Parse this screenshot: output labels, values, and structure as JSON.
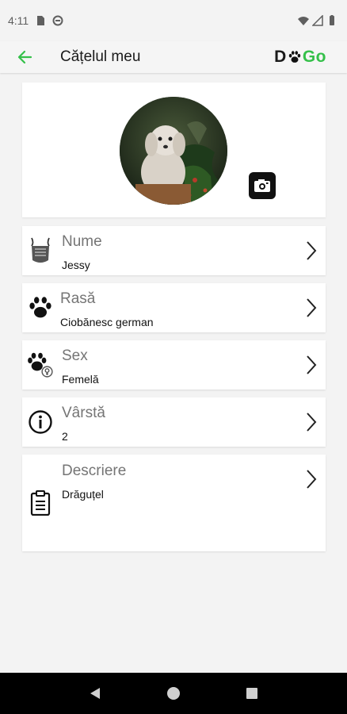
{
  "status_bar": {
    "time": "4:11"
  },
  "app_bar": {
    "title": "Cățelul meu",
    "brand_left": "D",
    "brand_right": "Go"
  },
  "fields": [
    {
      "label": "Nume",
      "value": "Jessy",
      "icon": "dog-tag-icon"
    },
    {
      "label": "Rasă",
      "value": "Ciobănesc german",
      "icon": "paw-icon"
    },
    {
      "label": "Sex",
      "value": "Femelă",
      "icon": "paw-gender-icon"
    },
    {
      "label": "Vârstă",
      "value": "2",
      "icon": "info-icon"
    },
    {
      "label": "Descriere",
      "value": "Drăguțel",
      "icon": "clipboard-icon"
    }
  ],
  "colors": {
    "accent": "#35c04a",
    "background": "#f3f3f3",
    "card": "#ffffff"
  }
}
